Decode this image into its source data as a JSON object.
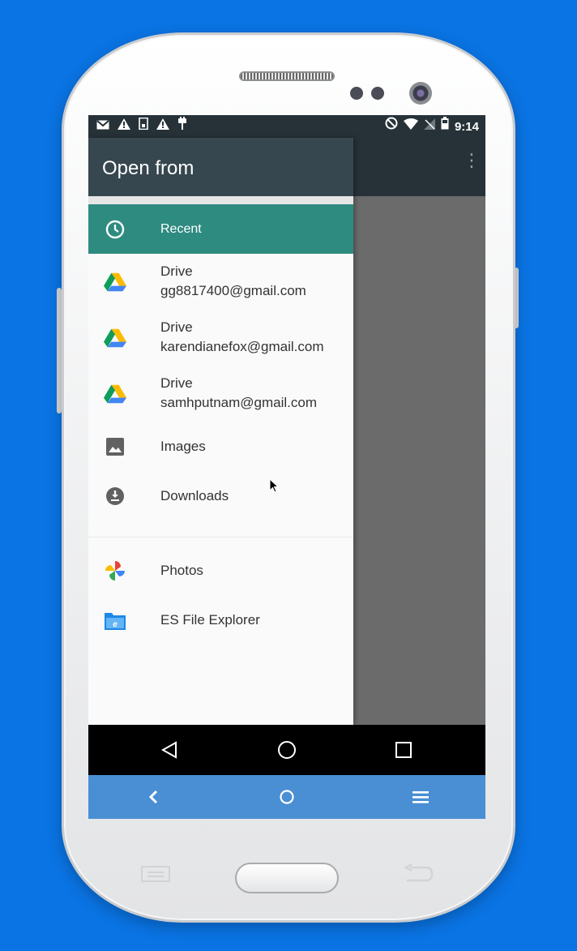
{
  "status_bar": {
    "time": "9:14",
    "left_icons": [
      "gmail-icon",
      "warning-icon",
      "sd-card-icon",
      "warning-icon",
      "usb-debug-icon"
    ],
    "right_icons": [
      "do-not-disturb-icon",
      "wifi-icon",
      "no-signal-icon",
      "battery-icon"
    ]
  },
  "drawer": {
    "title": "Open from",
    "items": [
      {
        "icon": "clock-icon",
        "lines": [
          "Recent"
        ],
        "selected": true
      },
      {
        "icon": "drive-icon",
        "lines": [
          "Drive",
          "gg8817400@gmail.com"
        ]
      },
      {
        "icon": "drive-icon",
        "lines": [
          "Drive",
          "karendianefox@gmail.com"
        ]
      },
      {
        "icon": "drive-icon",
        "lines": [
          "Drive",
          "samhputnam@gmail.com"
        ]
      },
      {
        "icon": "image-icon",
        "lines": [
          "Images"
        ]
      },
      {
        "icon": "download-icon",
        "lines": [
          "Downloads"
        ]
      }
    ],
    "apps": [
      {
        "icon": "photos-icon",
        "label": "Photos"
      },
      {
        "icon": "es-file-explorer-icon",
        "label": "ES File Explorer"
      }
    ]
  },
  "colors": {
    "background": "#0a74e4",
    "selected_item": "#2e8b80",
    "drawer_header": "#37474f",
    "status_bar": "#263238",
    "emulator_bar": "#4a8ed4"
  }
}
